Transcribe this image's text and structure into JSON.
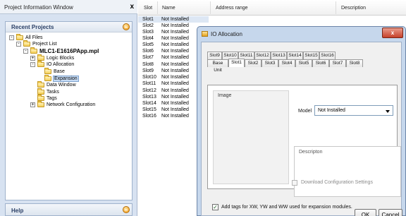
{
  "left_panel": {
    "title": "Project Information Window",
    "close_label": "x",
    "recent_projects_label": "Recent Projects",
    "help_label": "Help",
    "tree": {
      "all_files": "All Files",
      "project_list": "Project List",
      "project": "MLC1-E1616PApp.mpl",
      "logic_blocks": "Logic Blocks",
      "io_allocation": "IO Allocation",
      "base": "Base",
      "expansion": "Expansion",
      "data_window": "Data Window",
      "tasks": "Tasks",
      "tags": "Tags",
      "network_configuration": "Network Configuration",
      "expand_symbol": "+",
      "collapse_symbol": "-"
    }
  },
  "table": {
    "headers": {
      "slot": "Slot",
      "name": "Name",
      "address_range": "Address range",
      "description": "Description"
    },
    "rows": [
      {
        "slot": "Slot1",
        "name": "Not Installed"
      },
      {
        "slot": "Slot2",
        "name": "Not Installed"
      },
      {
        "slot": "Slot3",
        "name": "Not Installed"
      },
      {
        "slot": "Slot4",
        "name": "Not Installed"
      },
      {
        "slot": "Slot5",
        "name": "Not Installed"
      },
      {
        "slot": "Slot6",
        "name": "Not Installed"
      },
      {
        "slot": "Slot7",
        "name": "Not Installed"
      },
      {
        "slot": "Slot8",
        "name": "Not Installed"
      },
      {
        "slot": "Slot9",
        "name": "Not Installed"
      },
      {
        "slot": "Slot10",
        "name": "Not Installed"
      },
      {
        "slot": "Slot11",
        "name": "Not Installed"
      },
      {
        "slot": "Slot12",
        "name": "Not Installed"
      },
      {
        "slot": "Slot13",
        "name": "Not Installed"
      },
      {
        "slot": "Slot14",
        "name": "Not Installed"
      },
      {
        "slot": "Slot15",
        "name": "Not Installed"
      },
      {
        "slot": "Slot16",
        "name": "Not Installed"
      }
    ]
  },
  "dialog": {
    "title": "IO Allocation",
    "close_label": "x",
    "tabs_row1": [
      "Slot9",
      "Slot10",
      "Slot11",
      "Slot12",
      "Slot13",
      "Slot14",
      "Slot15",
      "Slot16"
    ],
    "tabs_row2": [
      "Base Unit",
      "Slot1",
      "Slot2",
      "Slot3",
      "Slot4",
      "Slot5",
      "Slot6",
      "Slot7",
      "Slot8"
    ],
    "active_tab": "Slot1",
    "image_label": "Image",
    "model_label": "Model",
    "model_value": "Not Installed",
    "description_label": "Descripton",
    "download_label": "Download Configuration Settings",
    "download_checked": false,
    "add_tags_label": "Add tags for XW, YW and WW used for expansion modules.",
    "add_tags_checked": true,
    "checkmark": "✓",
    "ok_label": "OK",
    "cancel_label": "Cancel"
  },
  "colors": {
    "panel_bg": "#d7e2f1",
    "dialog_frame": "#c6d7ec",
    "close_red": "#c6402a",
    "selection": "#c7dcf5"
  }
}
